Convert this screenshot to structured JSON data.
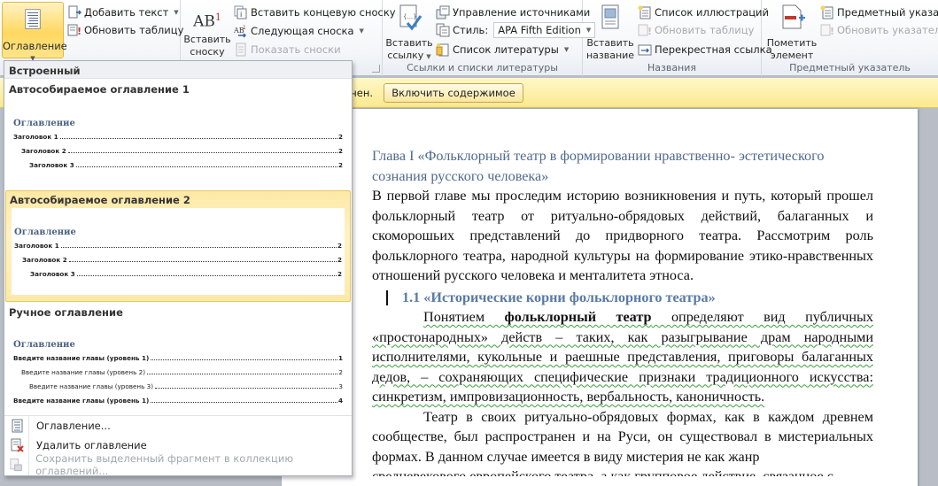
{
  "ribbon": {
    "groups": [
      {
        "label": "",
        "big_button": {
          "label": "Оглавление",
          "icon": "table-of-contents-icon",
          "active": true
        },
        "small_buttons": [
          {
            "label": "Добавить текст",
            "icon": "add-text-icon",
            "dropdown": true,
            "disabled": false
          },
          {
            "label": "Обновить таблицу",
            "icon": "update-table-icon",
            "dropdown": false,
            "disabled": false
          }
        ]
      },
      {
        "label": "",
        "big_button": {
          "label_line1": "Вставить",
          "label_line2": "сноску",
          "icon": "insert-footnote-icon",
          "glyph": "AB",
          "sup": "1"
        },
        "small_buttons": [
          {
            "label": "Вставить концевую сноску",
            "icon": "insert-endnote-icon",
            "disabled": false
          },
          {
            "label": "Следующая сноска",
            "icon": "next-footnote-icon",
            "dropdown": true,
            "disabled": false
          },
          {
            "label": "Показать сноски",
            "icon": "show-notes-icon",
            "disabled": true
          }
        ]
      },
      {
        "label": "Ссылки и списки литературы",
        "big_button": {
          "label_line1": "Вставить",
          "label_line2": "ссылку",
          "icon": "insert-citation-icon",
          "dropdown": true
        },
        "small_buttons": [
          {
            "label": "Управление источниками",
            "icon": "manage-sources-icon",
            "disabled": false
          },
          {
            "label": "Стиль:",
            "icon": "style-icon",
            "combo_value": "APA Fifth Edition"
          },
          {
            "label": "Список литературы",
            "icon": "bibliography-icon",
            "dropdown": true,
            "disabled": false
          }
        ]
      },
      {
        "label": "Названия",
        "big_button": {
          "label_line1": "Вставить",
          "label_line2": "название",
          "icon": "insert-caption-icon"
        },
        "small_buttons": [
          {
            "label": "Список иллюстраций",
            "icon": "table-of-figures-icon",
            "disabled": false
          },
          {
            "label": "Обновить таблицу",
            "icon": "update-table-icon",
            "disabled": true
          },
          {
            "label": "Перекрестная ссылка",
            "icon": "cross-reference-icon",
            "disabled": false
          }
        ]
      },
      {
        "label": "Предметный указатель",
        "big_button": {
          "label_line1": "Пометить",
          "label_line2": "элемент",
          "icon": "mark-entry-icon"
        },
        "small_buttons": [
          {
            "label": "Предметный указатель",
            "icon": "insert-index-icon",
            "disabled": false
          },
          {
            "label": "Обновить указатель",
            "icon": "update-index-icon",
            "disabled": true
          }
        ]
      }
    ]
  },
  "message_bar": {
    "text": "чен.",
    "button_label": "Включить содержимое"
  },
  "gallery": {
    "header": "Встроенный",
    "items": [
      {
        "title": "Автособираемое оглавление 1",
        "preview_title": "Оглавление",
        "lines": [
          {
            "text": "Заголовок 1",
            "page": "2",
            "level": 1
          },
          {
            "text": "Заголовок 2",
            "page": "2",
            "level": 2
          },
          {
            "text": "Заголовок 3",
            "page": "2",
            "level": 3
          }
        ],
        "selected": false
      },
      {
        "title": "Автособираемое оглавление 2",
        "preview_title": "Оглавление",
        "lines": [
          {
            "text": "Заголовок 1",
            "page": "2",
            "level": 1
          },
          {
            "text": "Заголовок 2",
            "page": "2",
            "level": 2
          },
          {
            "text": "Заголовок 3",
            "page": "2",
            "level": 3
          }
        ],
        "selected": true
      },
      {
        "title": "Ручное оглавление",
        "preview_title": "Оглавление",
        "lines": [
          {
            "text": "Введите название главы (уровень 1)",
            "page": "1",
            "level": 1
          },
          {
            "text": "Введите название главы (уровень 2)",
            "page": "2",
            "level": 2
          },
          {
            "text": "Введите название главы (уровень 3)",
            "page": "3",
            "level": 3
          },
          {
            "text": "Введите название главы (уровень 1)",
            "page": "4",
            "level": 1
          }
        ],
        "selected": false
      }
    ],
    "menu": [
      {
        "label": "Оглавление...",
        "icon": "table-of-contents-dialog-icon",
        "disabled": false
      },
      {
        "label": "Удалить оглавление",
        "icon": "remove-toc-icon",
        "disabled": false
      },
      {
        "label": "Сохранить выделенный фрагмент в коллекцию оглавлений...",
        "icon": "save-selection-icon",
        "disabled": true
      }
    ]
  },
  "document": {
    "chapter_heading": "Глава I  «Фольклорный театр в формировании нравственно-   эстетического сознания  русского человека»",
    "intro": "В первой главе мы проследим историю возникновения и путь, который прошел фольклорный театр от ритуально-обрядовых действий, балаганных и скоморошьих представлений до придворного театра. Рассмотрим роль фольклорного театра, народной культуры на формирование этико-нравственных отношений русского человека и менталитета этноса.",
    "section_heading": "1.1 «Исторические корни фольклорного театра»",
    "para1": {
      "lead": "Понятием ",
      "bold": "фольклорный театр",
      "rest": " определяют вид публичных «простонародных» действ – таких, как разыгрывание драм народными исполнителями, кукольные и раешные представления, приговоры балаганных дедов, – сохраняющих специфические признаки традиционного искусства: синкретизм, импровизационность, вербальность, каноничность."
    },
    "para2": "Театр в своих ритуально-обрядовых формах, как в каждом древнем сообществе, был распространен и на Руси, он существовал в мистериальных формах. В данном случае имеется в виду мистерия не как жанр",
    "para2_cut": "средневекового европейского театра, а как групповое действие, связанное с"
  }
}
